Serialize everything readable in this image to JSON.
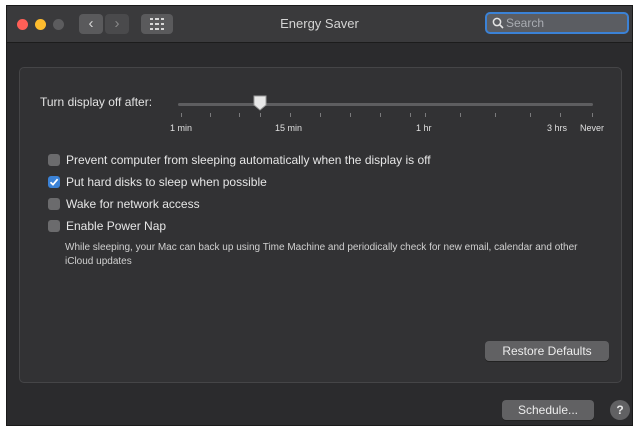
{
  "window": {
    "title": "Energy Saver",
    "search_placeholder": "Search"
  },
  "nav": {
    "back_glyph": "‹",
    "forward_glyph": "›"
  },
  "icons": {
    "close": "close-traffic-light",
    "minimize": "minimize-traffic-light",
    "zoom": "zoom-traffic-light",
    "grid": "grid-icon",
    "search": "search-icon",
    "checkmark": "checkmark-icon"
  },
  "colors": {
    "accent": "#3b82d6",
    "close": "#fe5f57",
    "minimize": "#febc2e",
    "window_bg": "#2b2b2d"
  },
  "display_slider": {
    "label": "Turn display off after:",
    "value": "15 min",
    "ticks": [
      "1 min",
      "15 min",
      "1 hr",
      "3 hrs",
      "Never"
    ]
  },
  "options": [
    {
      "label": "Prevent computer from sleeping automatically when the display is off",
      "checked": false
    },
    {
      "label": "Put hard disks to sleep when possible",
      "checked": true
    },
    {
      "label": "Wake for network access",
      "checked": false
    },
    {
      "label": "Enable Power Nap",
      "checked": false,
      "description": "While sleeping, your Mac can back up using Time Machine and periodically check for new email, calendar and other iCloud updates"
    }
  ],
  "buttons": {
    "restore_defaults": "Restore Defaults",
    "schedule": "Schedule...",
    "help": "?"
  }
}
